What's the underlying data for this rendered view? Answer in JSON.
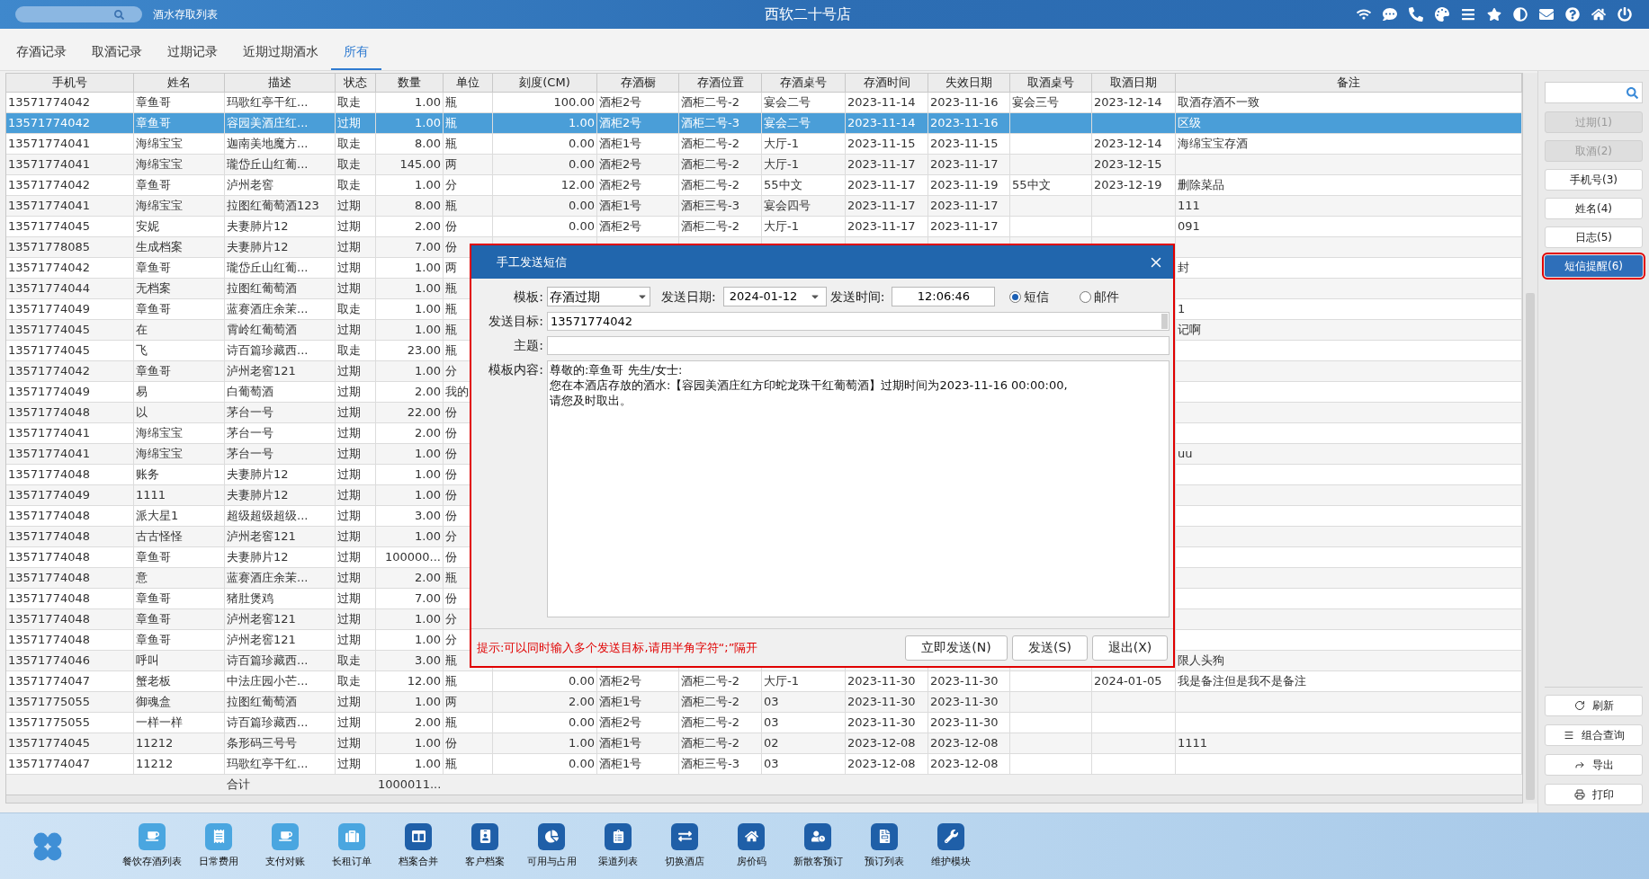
{
  "top_bar": {
    "page_title": "酒水存取列表",
    "store_name": "西软二十号店"
  },
  "tabs": [
    {
      "label": "存酒记录",
      "selected": false
    },
    {
      "label": "取酒记录",
      "selected": false
    },
    {
      "label": "过期记录",
      "selected": false
    },
    {
      "label": "近期过期酒水",
      "selected": false
    },
    {
      "label": "所有",
      "selected": true
    }
  ],
  "table": {
    "columns": [
      "手机号",
      "姓名",
      "描述",
      "状态",
      "数量",
      "单位",
      "刻度(CM)",
      "存酒橱",
      "存酒位置",
      "存酒桌号",
      "存酒时间",
      "失效日期",
      "取酒桌号",
      "取酒日期",
      "备注"
    ],
    "rows": [
      {
        "selected": false,
        "phone": "13571774042",
        "name": "章鱼哥",
        "desc": "玛歌红亭干红...",
        "status": "取走",
        "qty": "1.00",
        "unit": "瓶",
        "scale": "100.00",
        "cabinet": "酒柜2号",
        "position": "酒柜二号-2",
        "table_no": "宴会二号",
        "store_time": "2023-11-14",
        "expire_date": "2023-11-16",
        "take_table": "宴会三号",
        "take_date": "2023-12-14",
        "note": "取酒存酒不一致"
      },
      {
        "selected": true,
        "phone": "13571774042",
        "name": "章鱼哥",
        "desc": "容园美酒庄红...",
        "status": "过期",
        "qty": "1.00",
        "unit": "瓶",
        "scale": "1.00",
        "cabinet": "酒柜2号",
        "position": "酒柜二号-3",
        "table_no": "宴会二号",
        "store_time": "2023-11-14",
        "expire_date": "2023-11-16",
        "note": "区级"
      },
      {
        "selected": false,
        "phone": "13571774041",
        "name": "海绵宝宝",
        "desc": "迦南美地魔方...",
        "status": "取走",
        "qty": "8.00",
        "unit": "瓶",
        "scale": "0.00",
        "cabinet": "酒柜1号",
        "position": "酒柜二号-2",
        "table_no": "大厅-1",
        "store_time": "2023-11-15",
        "expire_date": "2023-11-15",
        "take_date": "2023-12-14",
        "note": "海绵宝宝存酒"
      },
      {
        "selected": false,
        "phone": "13571774041",
        "name": "海绵宝宝",
        "desc": "瓏岱丘山红葡...",
        "status": "取走",
        "qty": "145.00",
        "unit": "两",
        "scale": "0.00",
        "cabinet": "酒柜2号",
        "position": "酒柜二号-2",
        "table_no": "大厅-1",
        "store_time": "2023-11-17",
        "expire_date": "2023-11-17",
        "take_date": "2023-12-15"
      },
      {
        "selected": false,
        "phone": "13571774042",
        "name": "章鱼哥",
        "desc": "泸州老窖",
        "status": "取走",
        "qty": "1.00",
        "unit": "分",
        "scale": "12.00",
        "cabinet": "酒柜2号",
        "position": "酒柜二号-2",
        "table_no": "55中文",
        "store_time": "2023-11-17",
        "expire_date": "2023-11-19",
        "take_table": "55中文",
        "take_date": "2023-12-19",
        "note": "删除菜品"
      },
      {
        "selected": false,
        "phone": "13571774041",
        "name": "海绵宝宝",
        "desc": "拉图红葡萄酒123",
        "status": "过期",
        "qty": "8.00",
        "unit": "瓶",
        "scale": "0.00",
        "cabinet": "酒柜1号",
        "position": "酒柜三号-3",
        "table_no": "宴会四号",
        "store_time": "2023-11-17",
        "expire_date": "2023-11-17",
        "note": "111"
      },
      {
        "selected": false,
        "phone": "13571774045",
        "name": "安妮",
        "desc": "夫妻肺片12",
        "status": "过期",
        "qty": "2.00",
        "unit": "份",
        "scale": "0.00",
        "cabinet": "酒柜2号",
        "position": "酒柜二号-2",
        "table_no": "大厅-1",
        "store_time": "2023-11-17",
        "expire_date": "2023-11-17",
        "note": "091"
      },
      {
        "selected": false,
        "phone": "13571778085",
        "name": "生成档案",
        "desc": "夫妻肺片12",
        "status": "过期",
        "qty": "7.00",
        "unit": "份"
      },
      {
        "selected": false,
        "phone": "13571774042",
        "name": "章鱼哥",
        "desc": "瓏岱丘山红葡...",
        "status": "过期",
        "qty": "1.00",
        "unit": "两",
        "note": "封"
      },
      {
        "selected": false,
        "phone": "13571774044",
        "name": "无档案",
        "desc": "拉图红葡萄酒",
        "status": "过期",
        "qty": "1.00",
        "unit": "瓶"
      },
      {
        "selected": false,
        "phone": "13571774049",
        "name": "章鱼哥",
        "desc": "蓝赛酒庄余茉...",
        "status": "取走",
        "qty": "1.00",
        "unit": "瓶",
        "note": "1"
      },
      {
        "selected": false,
        "phone": "13571774045",
        "name": "在",
        "desc": "霄岭红葡萄酒",
        "status": "过期",
        "qty": "1.00",
        "unit": "瓶",
        "note": "记啊"
      },
      {
        "selected": false,
        "phone": "13571774045",
        "name": "飞",
        "desc": "诗百篇珍藏西...",
        "status": "取走",
        "qty": "23.00",
        "unit": "瓶"
      },
      {
        "selected": false,
        "phone": "13571774042",
        "name": "章鱼哥",
        "desc": "泸州老窖121",
        "status": "过期",
        "qty": "1.00",
        "unit": "分"
      },
      {
        "selected": false,
        "phone": "13571774049",
        "name": "易",
        "desc": "白葡萄酒",
        "status": "过期",
        "qty": "2.00",
        "unit": "我的"
      },
      {
        "selected": false,
        "phone": "13571774048",
        "name": "以",
        "desc": "茅台一号",
        "status": "过期",
        "qty": "22.00",
        "unit": "份"
      },
      {
        "selected": false,
        "phone": "13571774041",
        "name": "海绵宝宝",
        "desc": "茅台一号",
        "status": "过期",
        "qty": "2.00",
        "unit": "份"
      },
      {
        "selected": false,
        "phone": "13571774041",
        "name": "海绵宝宝",
        "desc": "茅台一号",
        "status": "过期",
        "qty": "1.00",
        "unit": "份",
        "note": "uu"
      },
      {
        "selected": false,
        "phone": "13571774048",
        "name": "账务",
        "desc": "夫妻肺片12",
        "status": "过期",
        "qty": "1.00",
        "unit": "份"
      },
      {
        "selected": false,
        "phone": "13571774049",
        "name": "1111",
        "desc": "夫妻肺片12",
        "status": "过期",
        "qty": "1.00",
        "unit": "份"
      },
      {
        "selected": false,
        "phone": "13571774048",
        "name": "派大星1",
        "desc": "超级超级超级...",
        "status": "过期",
        "qty": "3.00",
        "unit": "份"
      },
      {
        "selected": false,
        "phone": "13571774048",
        "name": "古古怪怪",
        "desc": "泸州老窖121",
        "status": "过期",
        "qty": "1.00",
        "unit": "分"
      },
      {
        "selected": false,
        "phone": "13571774048",
        "name": "章鱼哥",
        "desc": "夫妻肺片12",
        "status": "过期",
        "qty": "100000...",
        "unit": "份"
      },
      {
        "selected": false,
        "phone": "13571774048",
        "name": "意",
        "desc": "蓝赛酒庄余茉...",
        "status": "过期",
        "qty": "2.00",
        "unit": "瓶"
      },
      {
        "selected": false,
        "phone": "13571774048",
        "name": "章鱼哥",
        "desc": "猪肚煲鸡",
        "status": "过期",
        "qty": "7.00",
        "unit": "份"
      },
      {
        "selected": false,
        "phone": "13571774048",
        "name": "章鱼哥",
        "desc": "泸州老窖121",
        "status": "过期",
        "qty": "1.00",
        "unit": "分"
      },
      {
        "selected": false,
        "phone": "13571774048",
        "name": "章鱼哥",
        "desc": "泸州老窖121",
        "status": "过期",
        "qty": "1.00",
        "unit": "分"
      },
      {
        "selected": false,
        "phone": "13571774046",
        "name": "呼叫",
        "desc": "诗百篇珍藏西...",
        "status": "取走",
        "qty": "3.00",
        "unit": "瓶",
        "note": "限人头狗"
      },
      {
        "selected": false,
        "phone": "13571774047",
        "name": "蟹老板",
        "desc": "中法庄园小芒...",
        "status": "取走",
        "qty": "12.00",
        "unit": "瓶",
        "scale": "0.00",
        "cabinet": "酒柜2号",
        "position": "酒柜二号-2",
        "table_no": "大厅-1",
        "store_time": "2023-11-30",
        "expire_date": "2023-11-30",
        "take_date": "2024-01-05",
        "note": "我是备注但是我不是备注"
      },
      {
        "selected": false,
        "phone": "13571775055",
        "name": "御魂盒",
        "desc": "拉图红葡萄酒",
        "status": "过期",
        "qty": "1.00",
        "unit": "两",
        "scale": "2.00",
        "cabinet": "酒柜1号",
        "position": "酒柜二号-2",
        "table_no": "03",
        "store_time": "2023-11-30",
        "expire_date": "2023-11-30"
      },
      {
        "selected": false,
        "phone": "13571775055",
        "name": "一样一样",
        "desc": "诗百篇珍藏西...",
        "status": "过期",
        "qty": "2.00",
        "unit": "瓶",
        "scale": "0.00",
        "cabinet": "酒柜2号",
        "position": "酒柜二号-2",
        "table_no": "03",
        "store_time": "2023-11-30",
        "expire_date": "2023-11-30"
      },
      {
        "selected": false,
        "phone": "13571774045",
        "name": "11212",
        "desc": "条形码三号号",
        "status": "过期",
        "qty": "1.00",
        "unit": "份",
        "scale": "1.00",
        "cabinet": "酒柜1号",
        "position": "酒柜二号-2",
        "table_no": "02",
        "store_time": "2023-12-08",
        "expire_date": "2023-12-08",
        "note": "1111"
      },
      {
        "selected": false,
        "phone": "13571774047",
        "name": "11212",
        "desc": "玛歌红亭干红...",
        "status": "过期",
        "qty": "1.00",
        "unit": "瓶",
        "scale": "0.00",
        "cabinet": "酒柜1号",
        "position": "酒柜三号-3",
        "table_no": "03",
        "store_time": "2023-12-08",
        "expire_date": "2023-12-08"
      }
    ],
    "total": {
      "label": "合计",
      "qty": "1000011..."
    }
  },
  "side_panel": {
    "buttons": [
      {
        "label": "过期(1)",
        "disabled": true,
        "selected": false
      },
      {
        "label": "取酒(2)",
        "disabled": true,
        "selected": false
      },
      {
        "label": "手机号(3)",
        "disabled": false,
        "selected": false
      },
      {
        "label": "姓名(4)",
        "disabled": false,
        "selected": false
      },
      {
        "label": "日志(5)",
        "disabled": false,
        "selected": false
      },
      {
        "label": "短信提醒(6)",
        "disabled": false,
        "selected": true
      }
    ],
    "actions": [
      "刷新",
      "组合查询",
      "导出",
      "打印"
    ]
  },
  "dialog": {
    "title": "手工发送短信",
    "template_label": "模板:",
    "template": "存酒过期",
    "date_label": "发送日期:",
    "date": "2024-01-12",
    "time_label": "发送时间:",
    "time": "12:06:46",
    "channels": [
      {
        "label": "短信",
        "selected": true
      },
      {
        "label": "邮件",
        "selected": false
      }
    ],
    "target_label": "发送目标:",
    "target": "13571774042",
    "subject_label": "主题:",
    "content_label": "模板内容:",
    "content": [
      "尊敬的:章鱼哥 先生/女士:",
      "您在本酒店存放的酒水:【容园美酒庄红方印蛇龙珠干红葡萄酒】过期时间为2023-11-16 00:00:00,",
      "请您及时取出。"
    ],
    "hint": "提示:可以同时输入多个发送目标,请用半角字符“;”隔开",
    "buttons": [
      "立即发送(N)",
      "发送(S)",
      "退出(X)"
    ]
  },
  "dock": [
    {
      "label": "餐饮存酒列表",
      "color": "#4aa6e0"
    },
    {
      "label": "日常费用",
      "color": "#4aa6e0"
    },
    {
      "label": "支付对账",
      "color": "#4aa6e0"
    },
    {
      "label": "长租订单",
      "color": "#4aa6e0"
    },
    {
      "label": "档案合并",
      "color": "#1f5fa8"
    },
    {
      "label": "客户档案",
      "color": "#1f5fa8"
    },
    {
      "label": "可用与占用",
      "color": "#1f5fa8"
    },
    {
      "label": "渠道列表",
      "color": "#1f5fa8"
    },
    {
      "label": "切换酒店",
      "color": "#1f5fa8"
    },
    {
      "label": "房价码",
      "color": "#1f5fa8"
    },
    {
      "label": "新散客预订",
      "color": "#1f5fa8"
    },
    {
      "label": "预订列表",
      "color": "#1f5fa8"
    },
    {
      "label": "维护模块",
      "color": "#1f5fa8"
    }
  ]
}
